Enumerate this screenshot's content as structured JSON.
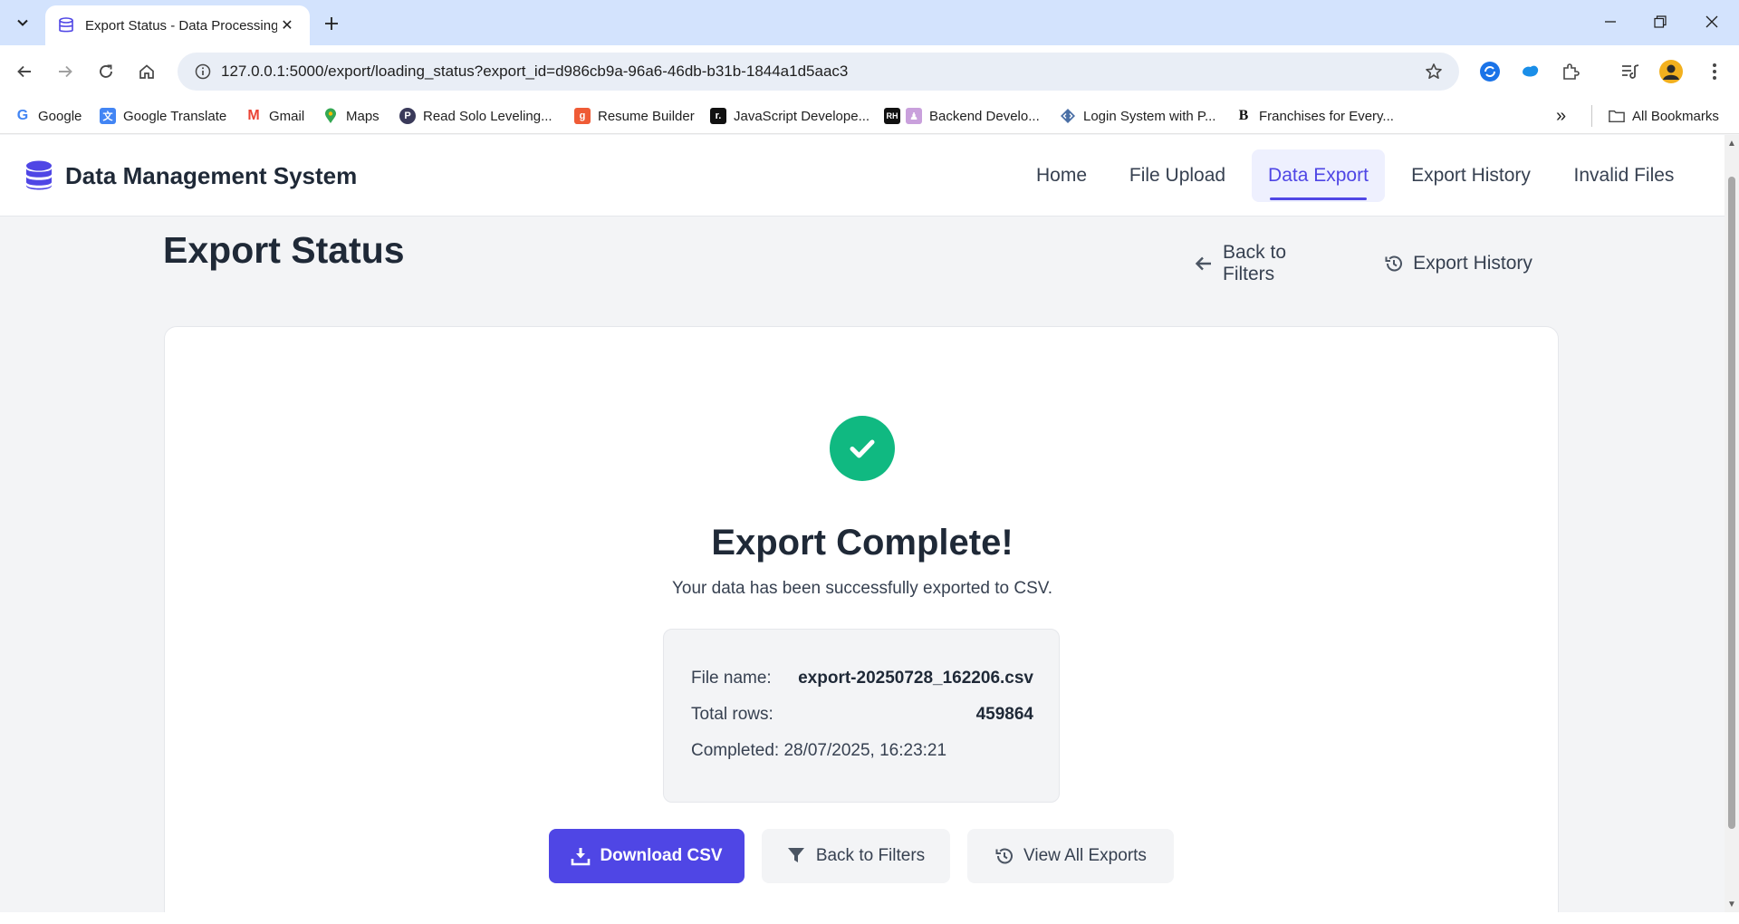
{
  "browser": {
    "tab_title": "Export Status - Data Processing",
    "url": "127.0.0.1:5000/export/loading_status?export_id=d986cb9a-96a6-46db-b31b-1844a1d5aac3",
    "bookmarks": [
      {
        "label": "Google",
        "icon": "google-icon"
      },
      {
        "label": "Google Translate",
        "icon": "translate-icon"
      },
      {
        "label": "Gmail",
        "icon": "gmail-icon"
      },
      {
        "label": "Maps",
        "icon": "maps-icon"
      },
      {
        "label": "Read Solo Leveling...",
        "icon": "p-icon"
      },
      {
        "label": "Resume Builder",
        "icon": "g-icon"
      },
      {
        "label": "JavaScript Develope...",
        "icon": "r-icon"
      },
      {
        "label": "Backend Develo...",
        "icon": "rh-icon"
      },
      {
        "label": "Login System with P...",
        "icon": "code-icon"
      },
      {
        "label": "Franchises for Every...",
        "icon": "b-icon"
      }
    ],
    "all_bookmarks": "All Bookmarks"
  },
  "app": {
    "brand": "Data Management System",
    "nav": [
      "Home",
      "File Upload",
      "Data Export",
      "Export History",
      "Invalid Files"
    ],
    "active_nav": "Data Export",
    "accent_color": "#4f46e5",
    "success_color": "#10b981"
  },
  "page": {
    "title": "Export Status",
    "back_to_filters": "Back to Filters",
    "export_history": "Export History"
  },
  "card": {
    "heading": "Export Complete!",
    "subtitle": "Your data has been successfully exported to CSV.",
    "file_name_label": "File name:",
    "file_name": "export-20250728_162206.csv",
    "total_rows_label": "Total rows:",
    "total_rows": "459864",
    "completed": "Completed: 28/07/2025, 16:23:21",
    "download_csv": "Download CSV",
    "back_to_filters": "Back to Filters",
    "view_all_exports": "View All Exports"
  }
}
